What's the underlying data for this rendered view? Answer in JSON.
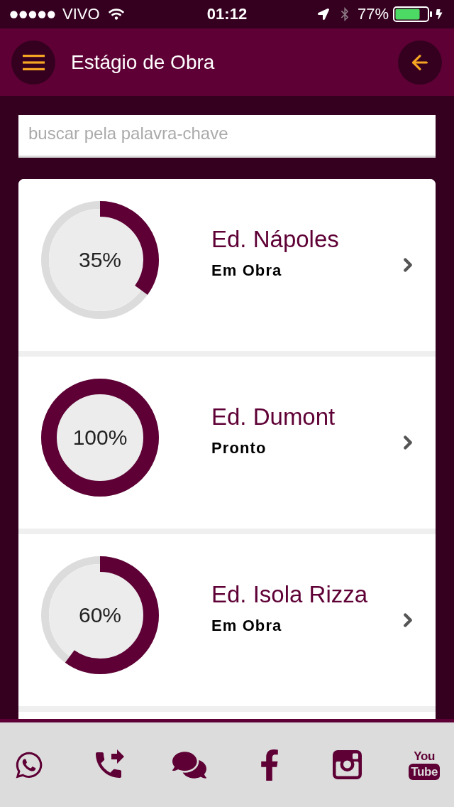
{
  "status_bar": {
    "carrier": "VIVO",
    "time": "01:12",
    "battery": "77%"
  },
  "header": {
    "title": "Estágio de Obra"
  },
  "search": {
    "placeholder": "buscar pela palavra-chave"
  },
  "projects": [
    {
      "name": "Ed. Nápoles",
      "status": "Em Obra",
      "reading": "35%",
      "level": 0.35
    },
    {
      "name": "Ed. Dumont",
      "status": "Pronto",
      "reading": "100%",
      "level": 1
    },
    {
      "name": "Ed. Isola Rizza",
      "status": "Em Obra",
      "reading": "60%",
      "level": 0.6
    }
  ],
  "footer": {
    "logo_words": [
      "You",
      "Tube"
    ]
  }
}
